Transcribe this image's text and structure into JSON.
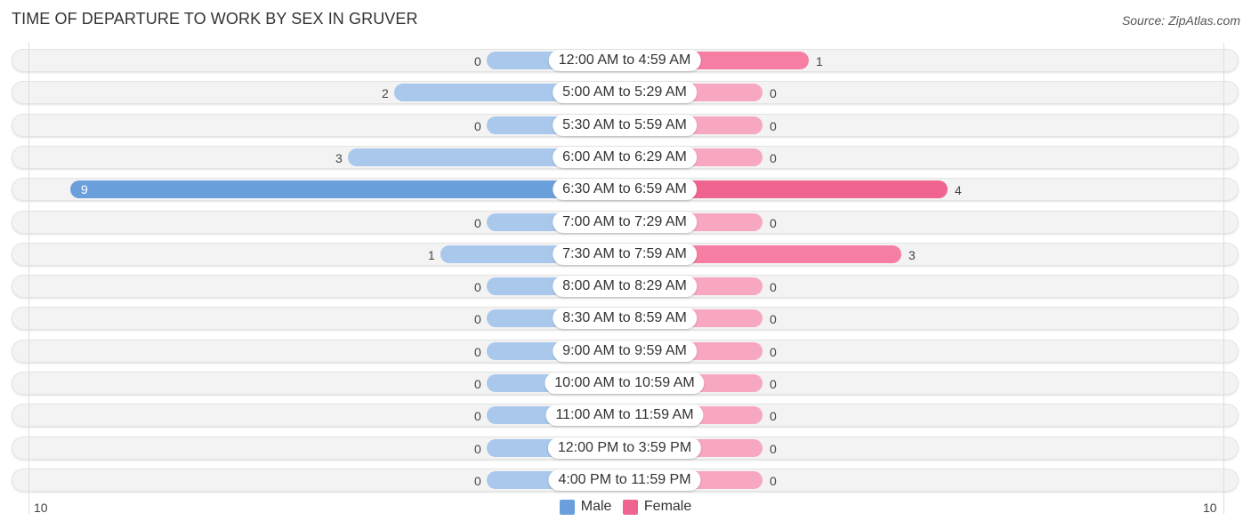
{
  "header": {
    "title": "TIME OF DEPARTURE TO WORK BY SEX IN GRUVER",
    "source": "Source: ZipAtlas.com"
  },
  "chart_data": {
    "type": "bar",
    "orientation": "horizontal-diverging",
    "title": "TIME OF DEPARTURE TO WORK BY SEX IN GRUVER",
    "categories": [
      "12:00 AM to 4:59 AM",
      "5:00 AM to 5:29 AM",
      "5:30 AM to 5:59 AM",
      "6:00 AM to 6:29 AM",
      "6:30 AM to 6:59 AM",
      "7:00 AM to 7:29 AM",
      "7:30 AM to 7:59 AM",
      "8:00 AM to 8:29 AM",
      "8:30 AM to 8:59 AM",
      "9:00 AM to 9:59 AM",
      "10:00 AM to 10:59 AM",
      "11:00 AM to 11:59 AM",
      "12:00 PM to 3:59 PM",
      "4:00 PM to 11:59 PM"
    ],
    "series": [
      {
        "name": "Male",
        "color": "#6a9fdc",
        "light_color": "#a9c8ec",
        "values": [
          0,
          2,
          0,
          3,
          9,
          0,
          1,
          0,
          0,
          0,
          0,
          0,
          0,
          0
        ]
      },
      {
        "name": "Female",
        "color": "#f06590",
        "light_color": "#f7a8c0",
        "values": [
          1,
          0,
          0,
          0,
          4,
          0,
          3,
          0,
          0,
          0,
          0,
          0,
          0,
          0
        ]
      }
    ],
    "xlim": [
      -10,
      10
    ],
    "axis_tick_labels": {
      "left": "10",
      "right": "10"
    },
    "legend": {
      "position": "bottom-center",
      "entries": [
        "Male",
        "Female"
      ]
    }
  }
}
